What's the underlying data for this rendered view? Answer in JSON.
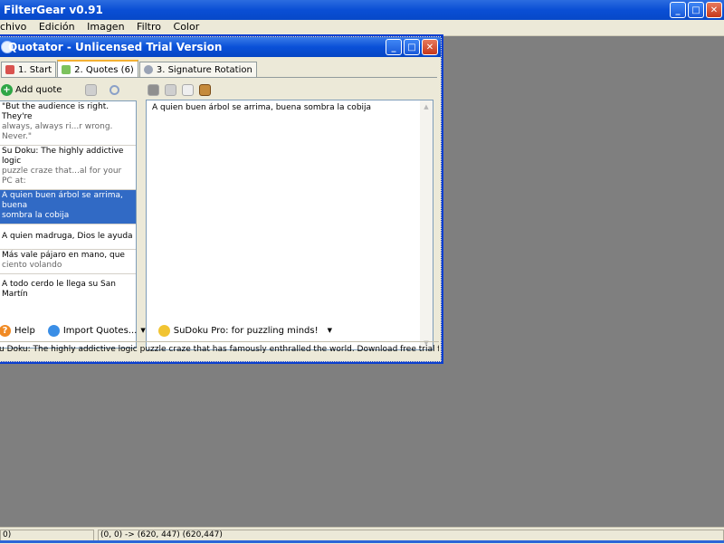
{
  "app": {
    "title": "FilterGear v0.91",
    "menu": [
      "chivo",
      "Edición",
      "Imagen",
      "Filtro",
      "Color"
    ],
    "window_buttons": {
      "min": "_",
      "max": "□",
      "close": "✕"
    }
  },
  "child": {
    "title": "Quotator - Unlicensed Trial Version",
    "tabs": [
      {
        "label": "1. Start",
        "icon": "pin-icon"
      },
      {
        "label": "2. Quotes (6)",
        "icon": "quotes-icon"
      },
      {
        "label": "3. Signature Rotation",
        "icon": "rotation-icon"
      }
    ],
    "toolbar": {
      "add_quote": "Add quote",
      "icons": [
        "database-icon",
        "search-icon",
        "binoculars-icon",
        "arrow-icon",
        "hand-icon",
        "book-icon"
      ]
    },
    "quotes": [
      {
        "line1": "\"But the audience is right. They're",
        "line2": "always, always ri...r wrong. Never.\""
      },
      {
        "line1": "Su Doku: The highly addictive logic",
        "line2": "puzzle craze that...al for your PC at:"
      },
      {
        "line1": "A quien buen árbol se arrima, buena",
        "line2": "sombra la cobija",
        "selected": true
      },
      {
        "line1": "A quien madruga, Dios le ayuda",
        "line2": ""
      },
      {
        "line1": "Más vale pájaro en mano, que",
        "line2": "ciento volando"
      },
      {
        "line1": "A todo cerdo le llega su San Martín",
        "line2": ""
      }
    ],
    "editor_text": "A quien buen árbol se arrima, buena sombra la cobija",
    "bottom": {
      "help": "Help",
      "import": "Import Quotes...",
      "sudoku": "SuDoku Pro: for puzzling minds!"
    },
    "status": "u Doku: The highly addictive logic puzzle craze that has famously enthralled the world. Download free trial for your PC ."
  },
  "status_bar": {
    "left": "0)",
    "right": "(0, 0) -> (620, 447)  (620,447)"
  }
}
